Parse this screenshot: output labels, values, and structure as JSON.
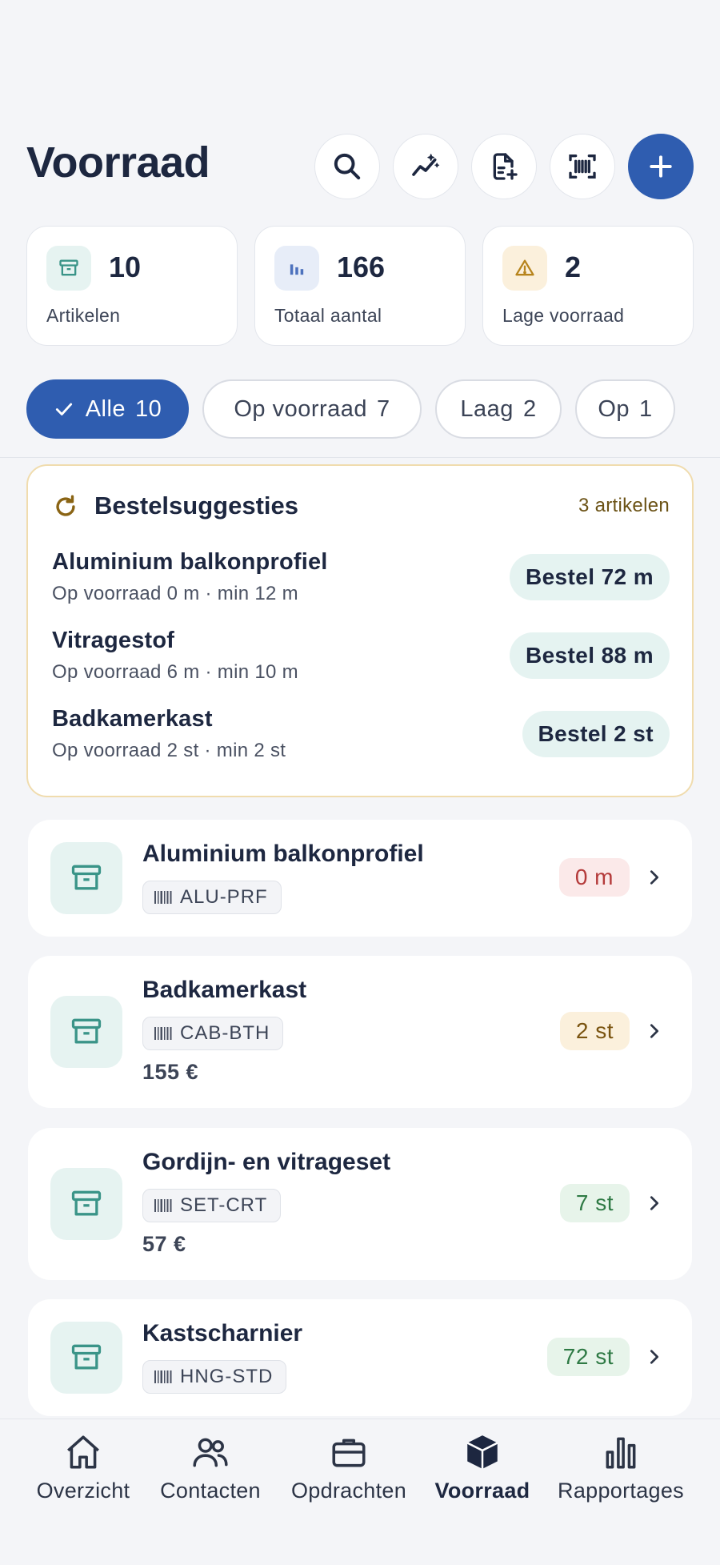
{
  "header": {
    "title": "Voorraad",
    "actions": [
      {
        "name": "search",
        "icon": "search-icon"
      },
      {
        "name": "insights",
        "icon": "sparkle-chart-icon"
      },
      {
        "name": "new-document",
        "icon": "file-plus-icon"
      },
      {
        "name": "scan",
        "icon": "barcode-scan-icon"
      },
      {
        "name": "add",
        "icon": "plus-icon"
      }
    ]
  },
  "stats": [
    {
      "value": "10",
      "label": "Artikelen",
      "icon": "archive-icon"
    },
    {
      "value": "166",
      "label": "Totaal aantal",
      "icon": "bar-chart-icon"
    },
    {
      "value": "2",
      "label": "Lage voorraad",
      "icon": "warning-icon"
    }
  ],
  "filters": [
    {
      "label": "Alle",
      "count": "10",
      "active": true
    },
    {
      "label": "Op voorraad",
      "count": "7",
      "active": false
    },
    {
      "label": "Laag",
      "count": "2",
      "active": false
    },
    {
      "label": "Op",
      "count": "1",
      "active": false
    }
  ],
  "suggestions": {
    "title": "Bestelsuggesties",
    "count_label": "3 artikelen",
    "items": [
      {
        "name": "Aluminium balkonprofiel",
        "detail": "Op voorraad 0 m · min 12 m",
        "action": "Bestel 72 m"
      },
      {
        "name": "Vitragestof",
        "detail": "Op voorraad 6 m · min 10 m",
        "action": "Bestel 88 m"
      },
      {
        "name": "Badkamerkast",
        "detail": "Op voorraad 2 st · min 2 st",
        "action": "Bestel 2 st"
      }
    ]
  },
  "items": [
    {
      "name": "Aluminium balkonprofiel",
      "sku": "ALU-PRF",
      "price": "",
      "qty": "0 m",
      "status": "red"
    },
    {
      "name": "Badkamerkast",
      "sku": "CAB-BTH",
      "price": "155 €",
      "qty": "2 st",
      "status": "amber"
    },
    {
      "name": "Gordijn- en vitrageset",
      "sku": "SET-CRT",
      "price": "57 €",
      "qty": "7 st",
      "status": "green"
    },
    {
      "name": "Kastscharnier",
      "sku": "HNG-STD",
      "price": "",
      "qty": "72 st",
      "status": "green"
    }
  ],
  "tabbar": [
    {
      "label": "Overzicht",
      "icon": "home-icon",
      "active": false
    },
    {
      "label": "Contacten",
      "icon": "users-icon",
      "active": false
    },
    {
      "label": "Opdrachten",
      "icon": "briefcase-icon",
      "active": false
    },
    {
      "label": "Voorraad",
      "icon": "box-icon",
      "active": true
    },
    {
      "label": "Rapportages",
      "icon": "bar-chart-icon",
      "active": false
    }
  ],
  "colors": {
    "primary": "#2f5db0",
    "background": "#f4f5f8",
    "text": "#1d2740",
    "suggestion_border": "#f0dcae",
    "teal_tint": "#e5f3f1",
    "stock_out": "#b43a3a",
    "stock_low": "#7a5410",
    "stock_ok": "#2f7a45"
  }
}
